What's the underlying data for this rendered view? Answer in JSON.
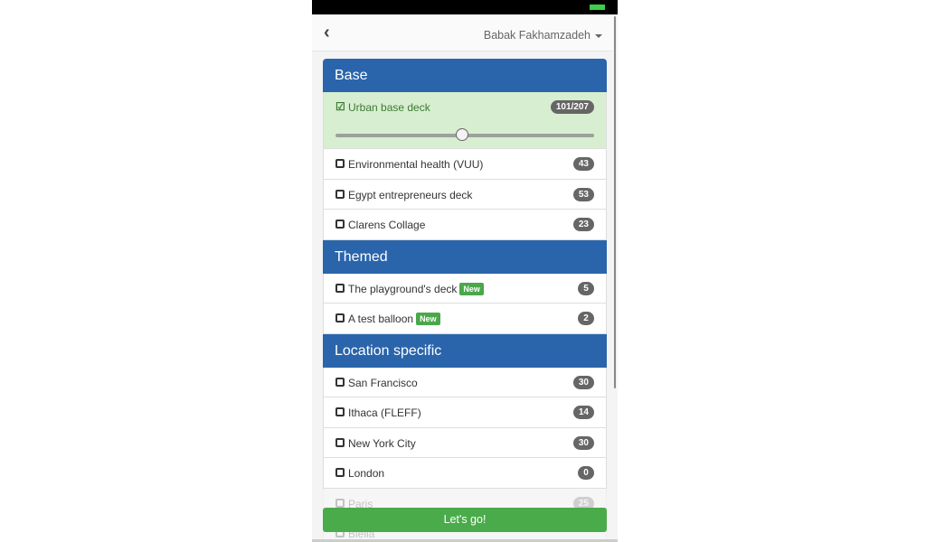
{
  "header": {
    "back_icon": "chevron-left-icon",
    "user_name": "Babak Fakhamzadeh"
  },
  "sections": [
    {
      "title": "Base",
      "items": [
        {
          "label": "Urban base deck",
          "count": "101/207",
          "selected": true,
          "slider_fraction": 0.49
        },
        {
          "label": "Environmental health (VUU)",
          "count": "43"
        },
        {
          "label": "Egypt entrepreneurs deck",
          "count": "53"
        },
        {
          "label": "Clarens Collage",
          "count": "23"
        }
      ]
    },
    {
      "title": "Themed",
      "items": [
        {
          "label": "The playground's deck",
          "count": "5",
          "new": "New"
        },
        {
          "label": "A test balloon",
          "count": "2",
          "new": "New"
        }
      ]
    },
    {
      "title": "Location specific",
      "items": [
        {
          "label": "San Francisco",
          "count": "30"
        },
        {
          "label": "Ithaca (FLEFF)",
          "count": "14"
        },
        {
          "label": "New York City",
          "count": "30"
        },
        {
          "label": "London",
          "count": "0"
        },
        {
          "label": "Paris",
          "count": "25"
        },
        {
          "label": "Biella",
          "count": ""
        }
      ]
    }
  ],
  "footer": {
    "go_label": "Let's go!"
  },
  "colors": {
    "section_header": "#2a65ab",
    "selected_row": "#d8eed0",
    "go_button": "#4aab4a",
    "badge": "#666666"
  }
}
